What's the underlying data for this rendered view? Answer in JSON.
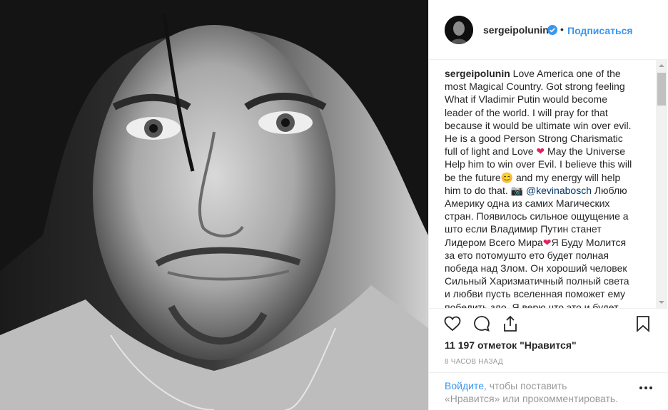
{
  "post": {
    "photo_alt": "Black and white portrait photo of a man with long dark hair",
    "author": {
      "username": "sergeipolunin",
      "verified": true,
      "dot": "•",
      "follow_label": "Подписаться"
    },
    "caption": {
      "username": "sergeipolunin",
      "part1": " Love America one of the most Magical Country. Got strong feeling What if Vladimir Putin would become leader of the world. I will pray for that because it would be ultimate win over evil. He is a good Person Strong Charismatic full of light and Love ",
      "heart1": "❤",
      "part2": " May the Universe Help him to win over Evil. I believe this will be the future",
      "smile": "😊",
      "part3": " and my energy will help him to do that. ",
      "camera": "📷",
      "mention": "@kevinabosch",
      "part4": " Люблю Америку одна из самих Магических стран. Появилось сильное ощущение а што если Владимир Путин станет Лидером Всего Мира",
      "heart2": "❤",
      "part5": "Я Буду Молится за ето потомушто ето будет полная победа над Злом. Он хороший человек Сильный Харизматичный полный света и любви пусть вселенная поможет ему победить зло. Я верю что это и будет"
    },
    "actions": {
      "like_icon": "heart-outline-icon",
      "comment_icon": "comment-bubble-icon",
      "share_icon": "share-arrow-icon",
      "save_icon": "bookmark-icon"
    },
    "likes_text": "11 197 отметок \"Нравится\"",
    "time_text": "8 часов назад",
    "login": {
      "link": "Войдите",
      "rest": ", чтобы поставить «Нравится» или прокомментировать."
    }
  },
  "colors": {
    "link_blue": "#3897f0",
    "verified_blue": "#3897f0",
    "heart_red": "#e0245e"
  }
}
